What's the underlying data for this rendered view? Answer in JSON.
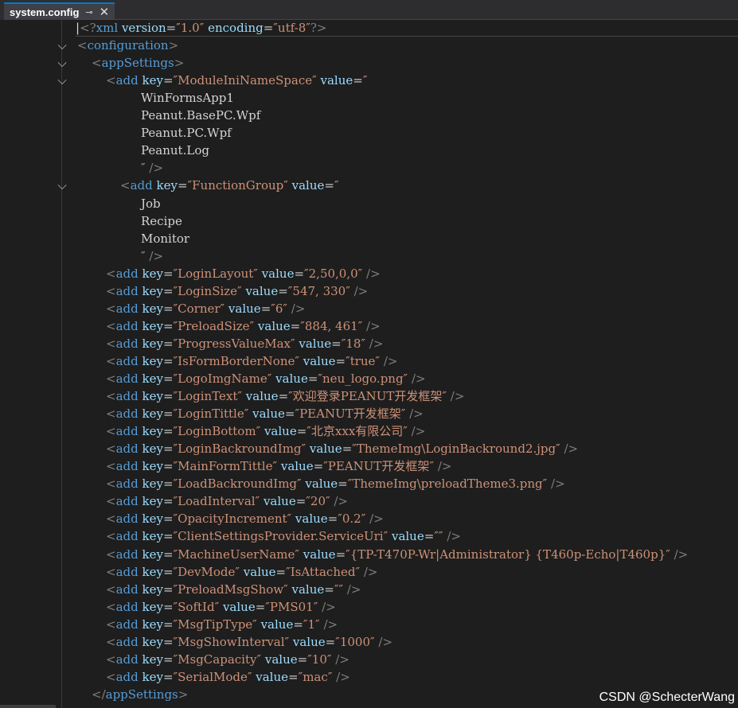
{
  "tab": {
    "title": "system.config",
    "pin_icon": "pin-icon",
    "close_icon": "close-icon"
  },
  "xml_declaration": {
    "name": "xml",
    "version_attr": "version",
    "version_val": "1.0",
    "encoding_attr": "encoding",
    "encoding_val": "utf-8"
  },
  "root_tag": "configuration",
  "section_tag": "appSettings",
  "multiline_entries": [
    {
      "key": "ModuleIniNameSpace",
      "lines": [
        "WinFormsApp1",
        "Peanut.BasePC.Wpf",
        "Peanut.PC.Wpf",
        "Peanut.Log"
      ]
    },
    {
      "key": "FunctionGroup",
      "lines": [
        "Job",
        "Recipe",
        "Monitor"
      ]
    }
  ],
  "entries": [
    {
      "key": "LoginLayout",
      "value": "2,50,0,0"
    },
    {
      "key": "LoginSize",
      "value": "547, 330"
    },
    {
      "key": "Corner",
      "value": "6"
    },
    {
      "key": "PreloadSize",
      "value": "884, 461"
    },
    {
      "key": "ProgressValueMax",
      "value": "18"
    },
    {
      "key": "IsFormBorderNone",
      "value": "true"
    },
    {
      "key": "LogoImgName",
      "value": "neu_logo.png"
    },
    {
      "key": "LoginText",
      "value": "欢迎登录PEANUT开发框架"
    },
    {
      "key": "LoginTittle",
      "value": "PEANUT开发框架"
    },
    {
      "key": "LoginBottom",
      "value": "北京xxx有限公司"
    },
    {
      "key": "LoginBackroundImg",
      "value": "ThemeImg\\LoginBackround2.jpg"
    },
    {
      "key": "MainFormTittle",
      "value": "PEANUT开发框架"
    },
    {
      "key": "LoadBackroundImg",
      "value": "ThemeImg\\preloadTheme3.png"
    },
    {
      "key": "LoadInterval",
      "value": "20"
    },
    {
      "key": "OpacityIncrement",
      "value": "0.2"
    },
    {
      "key": "ClientSettingsProvider.ServiceUri",
      "value": ""
    },
    {
      "key": "MachineUserName",
      "value": "{TP-T470P-Wr|Administrator} {T460p-Echo|T460p}"
    },
    {
      "key": "DevMode",
      "value": "IsAttached"
    },
    {
      "key": "PreloadMsgShow",
      "value": ""
    },
    {
      "key": "SoftId",
      "value": "PMS01"
    },
    {
      "key": "MsgTipType",
      "value": "1"
    },
    {
      "key": "MsgShowInterval",
      "value": "1000"
    },
    {
      "key": "MsgCapacity",
      "value": "10"
    },
    {
      "key": "SerialMode",
      "value": "mac"
    }
  ],
  "syntax": {
    "add_tag": "add",
    "key_attr": "key",
    "value_attr": "value"
  },
  "watermark": "CSDN @SchecterWang",
  "colors": {
    "tag": "#569cd6",
    "attribute": "#9cdcfe",
    "string": "#ce9178",
    "bracket": "#808080",
    "text": "#d4d4d4",
    "tab_accent": "#007acc"
  }
}
